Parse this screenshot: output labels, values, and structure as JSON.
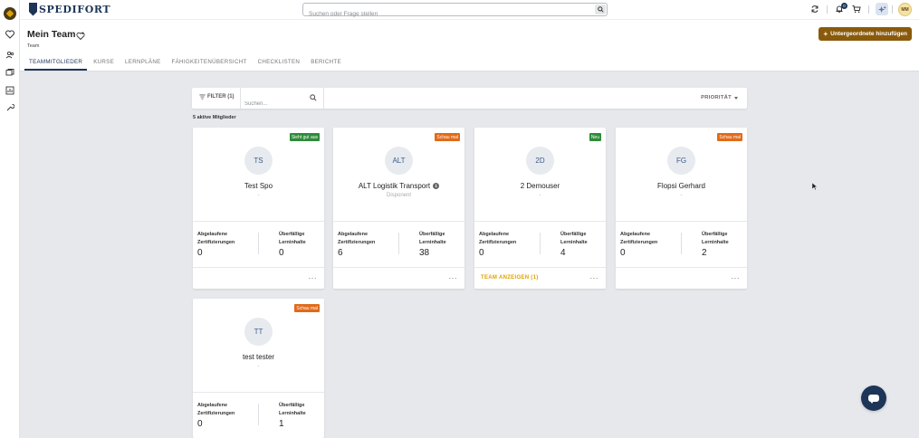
{
  "brand": {
    "name": "SPEDIFORT"
  },
  "topbar": {
    "search_placeholder": "Suchen oder Frage stellen",
    "notification_count": "0",
    "user_initials": "MM"
  },
  "page": {
    "title": "Mein Team",
    "subtitle": "Team",
    "add_button_label": "Untergeordnete hinzufügen"
  },
  "tabs": [
    {
      "label": "TEAMMITGLIEDER",
      "active": true
    },
    {
      "label": "KURSE"
    },
    {
      "label": "LERNPLÄNE"
    },
    {
      "label": "FÄHIGKEITENÜBERSICHT"
    },
    {
      "label": "CHECKLISTEN"
    },
    {
      "label": "BERICHTE"
    }
  ],
  "filterbar": {
    "filter_label": "FILTER (1)",
    "search_placeholder": "Suchen...",
    "sort_label": "PRIORITÄT"
  },
  "members_count_text": "5 aktive Mitglieder",
  "stat_labels": {
    "expired_line1": "Abgelaufene",
    "expired_line2": "Zertifizierungen",
    "overdue_line1": "Überfällige",
    "overdue_line2": "Lerninhalte"
  },
  "members": [
    {
      "initials": "TS",
      "name": "Test Spo",
      "role": "-",
      "tag": "Sieht gut aus",
      "tag_color": "#2e8b3a",
      "expired": "0",
      "overdue": "0",
      "team_link": ""
    },
    {
      "initials": "ALT",
      "name": "ALT Logistik Transport",
      "role": "Disponent",
      "tag": "Schau mal",
      "tag_color": "#e06a1a",
      "expired": "6",
      "overdue": "38",
      "team_link": ""
    },
    {
      "initials": "2D",
      "name": "2 Demouser",
      "role": "-",
      "tag": "Neu",
      "tag_color": "#2e8b3a",
      "expired": "0",
      "overdue": "4",
      "team_link": "TEAM ANZEIGEN (1)"
    },
    {
      "initials": "FG",
      "name": "Flopsi Gerhard",
      "role": "-",
      "tag": "Schau mal",
      "tag_color": "#e06a1a",
      "expired": "0",
      "overdue": "2",
      "team_link": ""
    },
    {
      "initials": "TT",
      "name": "test tester",
      "role": "-",
      "tag": "Schau mal",
      "tag_color": "#e06a1a",
      "expired": "0",
      "overdue": "1",
      "team_link": ""
    }
  ],
  "more_label": "···",
  "colors": {
    "brand": "#1d3557",
    "accent": "#8a5a0c",
    "link": "#e0a200",
    "positive": "#2e8b3a",
    "warning": "#e06a1a"
  }
}
